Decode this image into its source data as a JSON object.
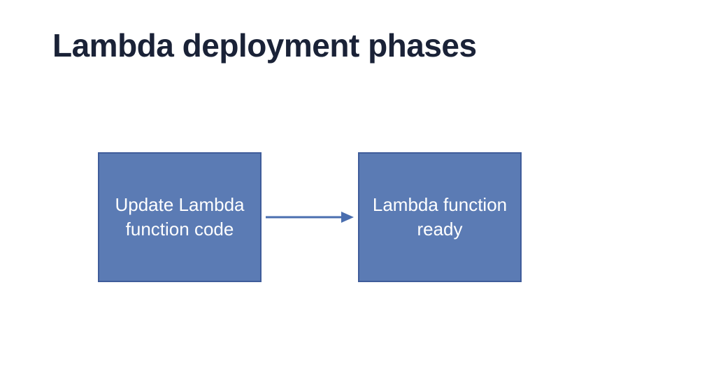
{
  "title": "Lambda deployment phases",
  "diagram": {
    "box1": "Update Lambda function code",
    "box2": "Lambda function ready"
  },
  "colors": {
    "box_fill": "#5b7bb4",
    "box_border": "#3f5c9a",
    "arrow": "#4a6eaf",
    "title": "#1a2237"
  }
}
